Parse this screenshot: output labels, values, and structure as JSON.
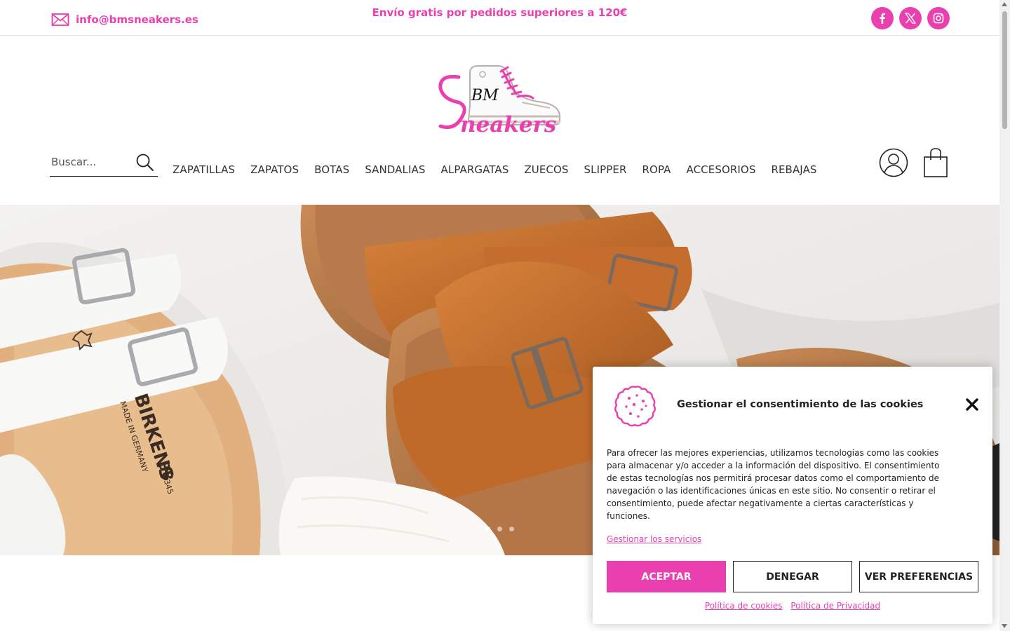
{
  "topbar": {
    "email": "info@bmsneakers.es",
    "promo": "Envío gratis por pedidos superiores a 120€",
    "social": [
      "facebook-icon",
      "x-icon",
      "instagram-icon"
    ]
  },
  "logo": {
    "line1": "BM",
    "line2": "Sneakers"
  },
  "search": {
    "placeholder": "Buscar..."
  },
  "nav": {
    "items": [
      "ZAPATILLAS",
      "ZAPATOS",
      "BOTAS",
      "SANDALIAS",
      "ALPARGATAS",
      "ZUECOS",
      "SLIPPER",
      "ROPA",
      "ACCESORIOS",
      "REBAJAS"
    ]
  },
  "hero": {
    "slide_count": 3,
    "active_slide": 1,
    "shoe_print": {
      "brand": "BIRKENS",
      "made_in": "MADE IN GERMANY",
      "size": "38",
      "size_alt": "345"
    }
  },
  "cookie": {
    "title": "Gestionar el consentimiento de las cookies",
    "body": "Para ofrecer las mejores experiencias, utilizamos tecnologías como las cookies para almacenar y/o acceder a la información del dispositivo. El consentimiento de estas tecnologías nos permitirá procesar datos como el comportamiento de navegación o las identificaciones únicas en este sitio. No consentir o retirar el consentimiento, puede afectar negativamente a ciertas características y funciones.",
    "manage_link": "Gestionar los servicios",
    "accept": "ACEPTAR",
    "deny": "DENEGAR",
    "preferences": "VER PREFERENCIAS",
    "cookie_policy": "Política de cookies",
    "privacy_policy": "Política de Privacidad"
  },
  "colors": {
    "brand_pink": "#ea3fae",
    "text_dark": "#222222"
  }
}
